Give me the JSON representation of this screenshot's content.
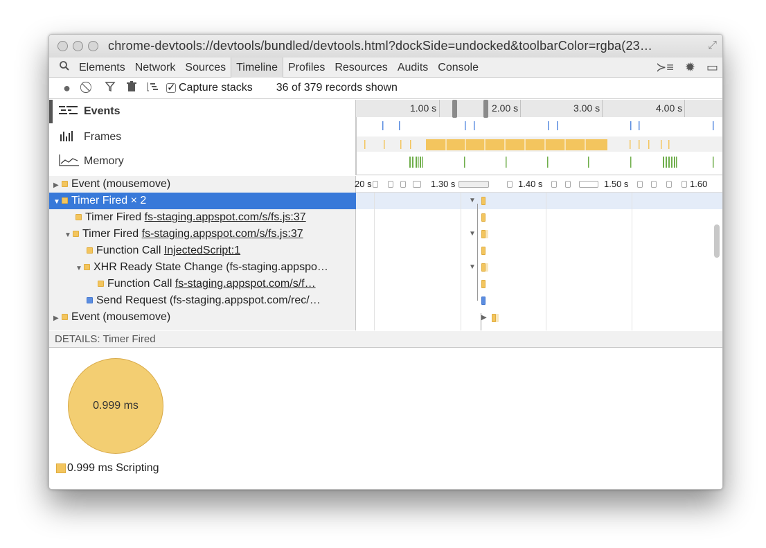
{
  "window": {
    "title": "chrome-devtools://devtools/bundled/devtools.html?dockSide=undocked&toolbarColor=rgba(23…"
  },
  "tabs": [
    "Elements",
    "Network",
    "Sources",
    "Timeline",
    "Profiles",
    "Resources",
    "Audits",
    "Console"
  ],
  "selected_tab": "Timeline",
  "toolbar": {
    "capture_stacks_label": "Capture stacks",
    "capture_stacks_checked": true,
    "records_shown": "36 of 379 records shown"
  },
  "overview": {
    "items": [
      {
        "label": "Events",
        "selected": true,
        "icon": "events-icon"
      },
      {
        "label": "Frames",
        "selected": false,
        "icon": "frames-icon"
      },
      {
        "label": "Memory",
        "selected": false,
        "icon": "memory-icon"
      }
    ],
    "ticks": [
      "1.00 s",
      "2.00 s",
      "3.00 s",
      "4.00 s"
    ]
  },
  "records": [
    {
      "depth": 0,
      "expander": "▶",
      "color": "yellow",
      "name": "Event",
      "detail": " (mousemove)",
      "link": false
    },
    {
      "depth": 0,
      "expander": "▼",
      "color": "yellow",
      "name": "Timer Fired",
      "detail": " × 2",
      "link": false,
      "selected": true
    },
    {
      "depth": 1,
      "expander": "",
      "color": "yellow",
      "name": "Timer Fired",
      "detail": "fs-staging.appspot.com/s/fs.js:37",
      "link": true
    },
    {
      "depth": 1,
      "expander": "▼",
      "color": "yellow",
      "name": "Timer Fired",
      "detail": "fs-staging.appspot.com/s/fs.js:37",
      "link": true
    },
    {
      "depth": 2,
      "expander": "",
      "color": "yellow",
      "name": "Function Call",
      "detail": "InjectedScript:1",
      "link": true
    },
    {
      "depth": 2,
      "expander": "▼",
      "color": "yellow",
      "name": "XHR Ready State Change",
      "detail": " (fs-staging.appspo…",
      "link": false
    },
    {
      "depth": 3,
      "expander": "",
      "color": "yellow",
      "name": "Function Call",
      "detail": "fs-staging.appspot.com/s/f…",
      "link": true
    },
    {
      "depth": 2,
      "expander": "",
      "color": "blue",
      "name": "Send Request",
      "detail": " (fs-staging.appspot.com/rec/…",
      "link": false
    },
    {
      "depth": 0,
      "expander": "▶",
      "color": "yellow",
      "name": "Event",
      "detail": " (mousemove)",
      "link": false
    }
  ],
  "record_ruler": [
    "20 s",
    "1.30 s",
    "1.40 s",
    "1.50 s",
    "1.60"
  ],
  "details": {
    "header": "DETAILS: Timer Fired",
    "pie_label": "0.999 ms",
    "legend": "0.999 ms Scripting",
    "scripting_color": "#f3c55e"
  },
  "colors": {
    "selection": "#3879d9",
    "scripting": "#f3c55e",
    "loading": "#5b8de0",
    "painting": "#6fae4b"
  }
}
